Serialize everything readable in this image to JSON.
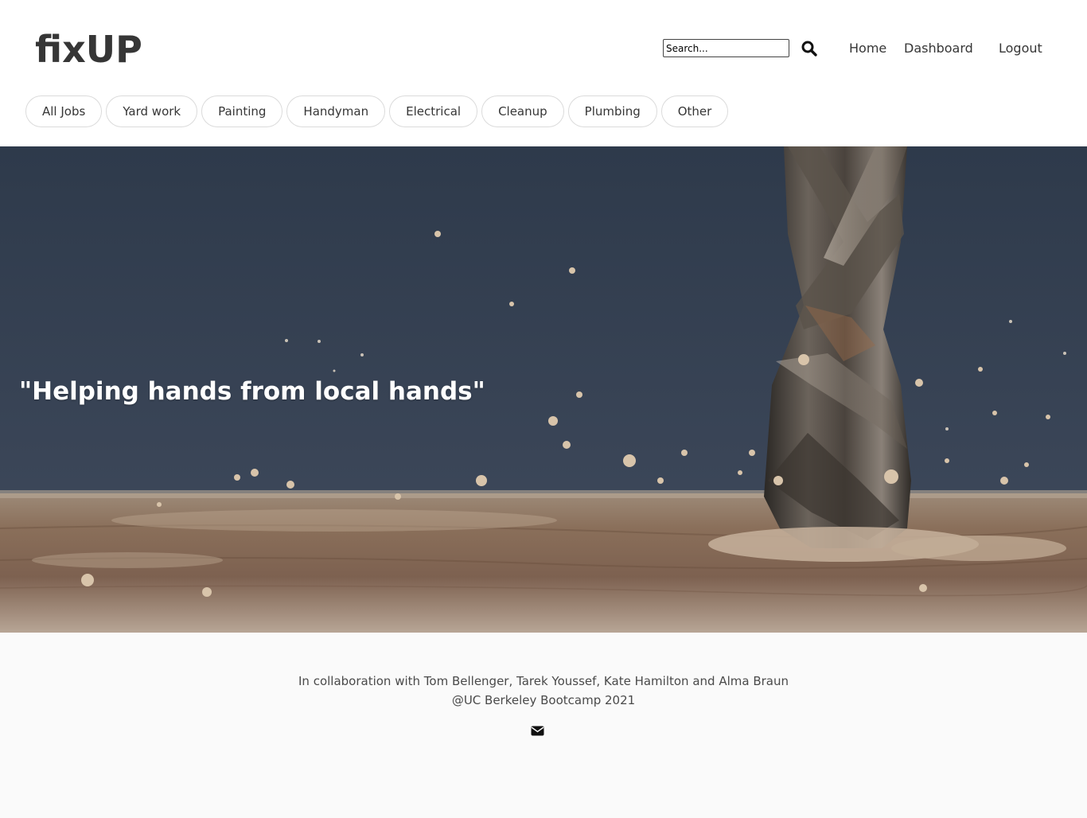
{
  "header": {
    "logo": "fixUP",
    "search": {
      "placeholder": "Search...",
      "icon": "search-icon"
    },
    "nav": {
      "home": "Home",
      "dashboard": "Dashboard",
      "logout": "Logout"
    }
  },
  "categories": [
    {
      "label": "All Jobs"
    },
    {
      "label": "Yard work"
    },
    {
      "label": "Painting"
    },
    {
      "label": "Handyman"
    },
    {
      "label": "Electrical"
    },
    {
      "label": "Cleanup"
    },
    {
      "label": "Plumbing"
    },
    {
      "label": "Other"
    }
  ],
  "hero": {
    "tagline": "\"Helping hands from local hands\"",
    "image": "drill-bit-in-wood-photo"
  },
  "footer": {
    "credits": "In collaboration with Tom Bellenger, Tarek Youssef, Kate Hamilton and Alma Braun",
    "bootcamp": "@UC Berkeley Bootcamp 2021",
    "icon": "envelope-icon"
  },
  "colors": {
    "text": "#363636",
    "pill_border": "#dbdbdb",
    "hero_background": "#35404f",
    "footer_background": "#fafafa"
  }
}
